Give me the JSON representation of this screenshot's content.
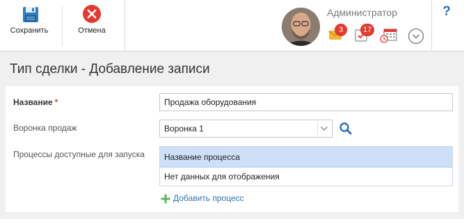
{
  "toolbar": {
    "save_label": "Сохранить",
    "cancel_label": "Отмена"
  },
  "user": {
    "name": "Администратор",
    "notifications": {
      "mail_count": "3",
      "tasks_count": "17"
    }
  },
  "help_label": "?",
  "page": {
    "title": "Тип сделки - Добавление записи"
  },
  "form": {
    "name_label": "Название",
    "required_mark": "*",
    "name_value": "Продажа оборудования",
    "funnel_label": "Воронка продаж",
    "funnel_value": "Воронка 1",
    "processes_label": "Процессы доступные для запуска",
    "processes_grid": {
      "column_header": "Название процесса",
      "empty_text": "Нет данных для отображения"
    },
    "add_process_label": "Добавить процесс"
  },
  "colors": {
    "accent_blue": "#2b73b7",
    "cancel_red": "#e23a2e",
    "badge_red": "#e23a2e",
    "grid_header_bg": "#cde0f8",
    "add_plus_green": "#5cb85c"
  },
  "icons": [
    "floppy-save-icon",
    "cancel-x-icon",
    "mail-icon",
    "task-check-icon",
    "calendar-icon",
    "chevron-down-circle-icon",
    "search-icon",
    "plus-icon"
  ]
}
